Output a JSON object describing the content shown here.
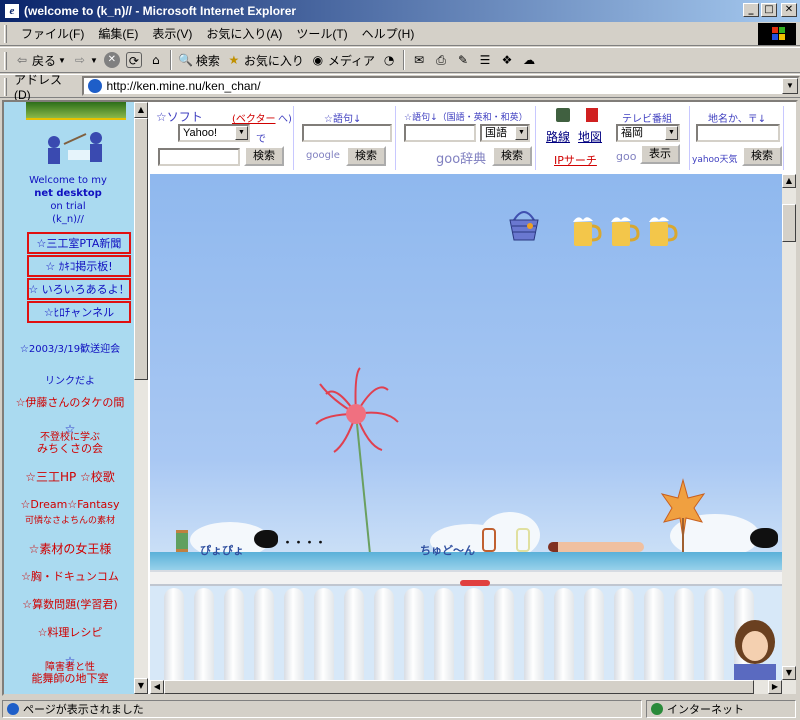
{
  "window": {
    "title": "(welcome to (k_n)// - Microsoft Internet Explorer",
    "app_icon_letter": "e"
  },
  "menubar": {
    "items": [
      "ファイル(F)",
      "編集(E)",
      "表示(V)",
      "お気に入り(A)",
      "ツール(T)",
      "ヘルプ(H)"
    ]
  },
  "toolbar": {
    "back_label": "戻る",
    "search_label": "検索",
    "favorites_label": "お気に入り",
    "media_label": "メディア"
  },
  "address": {
    "label": "アドレス(D)",
    "url": "http://ken.mine.nu/ken_chan/"
  },
  "left_frame": {
    "welcome_lines": [
      "Welcome to my",
      "net desktop",
      "on trial",
      "(k_n)//"
    ],
    "nav_boxes": [
      "☆三工室PTA新聞",
      "☆ ｶｷｺ掲示板!",
      "☆ いろいろあるよ！",
      "☆ﾋﾛﾁャンネル"
    ],
    "links": [
      {
        "text": "☆2003/3/19歓送迎会",
        "style": "blue"
      },
      {
        "text": "リンクだよ",
        "style": "small"
      },
      {
        "text": "☆伊藤さんのタケの間",
        "style": "red"
      },
      {
        "text": "☆",
        "style": "blue"
      },
      {
        "text": "不登校に学ぶ",
        "style": "red-small"
      },
      {
        "text": "みちくさの会",
        "style": "red"
      },
      {
        "text": "☆三工HP ☆校歌",
        "style": "red"
      },
      {
        "text": "☆Dream☆Fantasy",
        "style": "red"
      },
      {
        "text": "可憐なさよちんの素材",
        "style": "red-small"
      },
      {
        "text": "☆素材の女王様",
        "style": "red"
      },
      {
        "text": "☆胸・ドキュンコム",
        "style": "red"
      },
      {
        "text": "☆算数問題(学習君)",
        "style": "red"
      },
      {
        "text": "☆料理レシピ",
        "style": "red"
      },
      {
        "text": "☆",
        "style": "blue"
      },
      {
        "text": "障害者と性",
        "style": "red-small"
      },
      {
        "text": "能舞師の地下室",
        "style": "red"
      }
    ]
  },
  "searchbar": {
    "soft_label": "☆ソフト",
    "vector_link": "(ベクター",
    "vector_close": "へ)",
    "engine_select": "Yahoo!",
    "de": "で",
    "search_btn": "検索",
    "goroku1_label": "☆語句↓",
    "google_text": "google",
    "goroku2_label": "☆語句↓（国語・英和・和英）",
    "dict_select": "国語",
    "goo_dict": "goo辞典",
    "route_link": "路線",
    "map_link": "地図",
    "ip_link": "IPサーチ",
    "tv_label": "テレビ番組",
    "tv_select": "福岡",
    "goo_text": "goo",
    "show_btn": "表示",
    "place_label": "地名か、〒↓",
    "yahoo_weather": "yahoo天気"
  },
  "scene": {
    "sprite_text_1": "ぴょぴょ",
    "sprite_text_2": "ちゅど～ん",
    "dots": "・・・・"
  },
  "status": {
    "text": "ページが表示されました",
    "zone": "インターネット"
  },
  "colors": {
    "title_gradient_start": "#0a246a",
    "title_gradient_end": "#a6caf0",
    "left_bg": "#aadaf0",
    "sky": "#a7c3ef",
    "nav_border": "#e01010"
  }
}
